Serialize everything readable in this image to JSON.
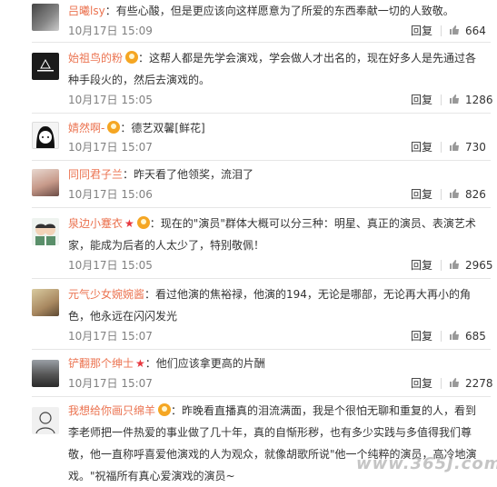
{
  "comments": [
    {
      "user": "吕曦lsy",
      "text": "有些心酸，但是更应该向这样愿意为了所爱的东西奉献一切的人致敬。",
      "date": "10月17日 15:09",
      "reply": "回复",
      "likes": "664"
    },
    {
      "user": "始祖鸟的粉",
      "text": "这帮人都是先学会演戏，学会做人才出名的，现在好多人是先通过各种手段火的，然后去演戏的。",
      "date": "10月17日 15:05",
      "reply": "回复",
      "likes": "1286"
    },
    {
      "user": "婧然啊-",
      "text": "德艺双馨[鲜花]",
      "date": "10月17日 15:07",
      "reply": "回复",
      "likes": "730"
    },
    {
      "user": "同同君子兰",
      "text": "昨天看了他领奖，流泪了",
      "date": "10月17日 15:06",
      "reply": "回复",
      "likes": "826"
    },
    {
      "user": "泉边小蹇衣",
      "text": "现在的\"演员\"群体大概可以分三种：明星、真正的演员、表演艺术家，能成为后者的人太少了，特别敬佩！",
      "date": "10月17日 15:05",
      "reply": "回复",
      "likes": "2965"
    },
    {
      "user": "元气少女婉婉酱",
      "text": "看过他演的焦裕禄，他演的194，无论是哪部，无论再大再小的角色，他永远在闪闪发光",
      "date": "10月17日 15:07",
      "reply": "回复",
      "likes": "685"
    },
    {
      "user": "铲翻那个绅士",
      "text": "他们应该拿更高的片酬",
      "date": "10月17日 15:07",
      "reply": "回复",
      "likes": "2278"
    },
    {
      "user": "我想给你画只绵羊",
      "text": "昨晚看直播真的泪流满面，我是个很怕无聊和重复的人，看到李老师把一件热爱的事业做了几十年，真的自惭形秽，也有多少实践与多值得我们尊敬，他一直称呼喜爱他演戏的人为观众，就像胡歌所说\"他一个纯粹的演员，高冷地演戏。\"祝福所有真心爱演戏的演员~"
    }
  ],
  "watermark": "www.365J.com",
  "colors": {
    "username": "#eb7350",
    "meta": "#808080",
    "badge": "#f5a623",
    "star": "#e8373e"
  },
  "icons": {
    "badge": "vip-badge-icon",
    "like": "thumb-up-icon",
    "star": "red-star-icon"
  }
}
